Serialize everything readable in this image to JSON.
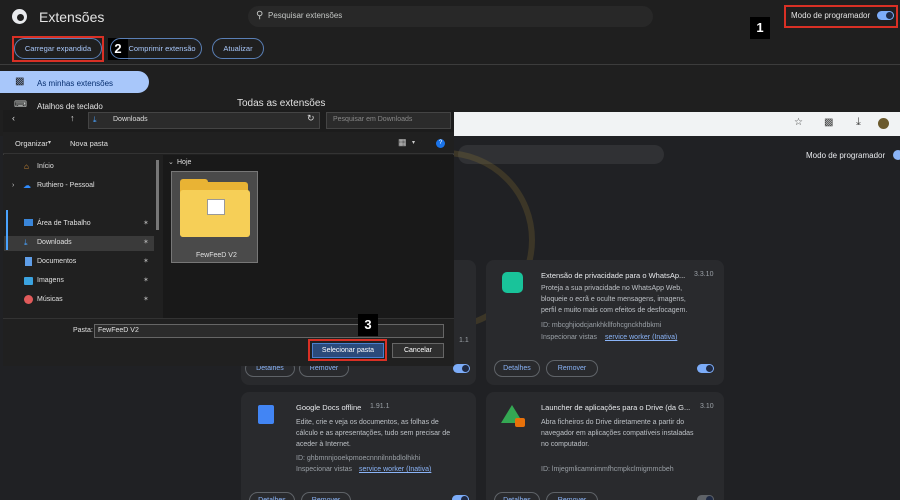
{
  "topbar": {
    "title": "Extensões",
    "search_placeholder": "Pesquisar extensões",
    "devmode_label": "Modo de programador"
  },
  "toolbar": {
    "load_unpacked": "Carregar expandida",
    "pack": "Comprimir extensão",
    "update": "Atualizar"
  },
  "sidebar": {
    "items": [
      {
        "label": "As minhas extensões"
      },
      {
        "label": "Atalhos de teclado"
      }
    ]
  },
  "main": {
    "all_extensions": "Todas as extensões",
    "devmode_label": "Modo de programador"
  },
  "annotations": [
    "1",
    "2",
    "3"
  ],
  "dialog": {
    "path": "Downloads",
    "search_placeholder": "Pesquisar em Downloads",
    "organize": "Organizar",
    "new_folder": "Nova pasta",
    "nav_items": [
      {
        "label": "Início",
        "icon": "home-icon"
      },
      {
        "label": "Ruthiero - Pessoal",
        "icon": "cloud-icon"
      },
      {
        "label": "Área de Trabalho",
        "icon": "desktop-icon"
      },
      {
        "label": "Downloads",
        "icon": "download-icon"
      },
      {
        "label": "Documentos",
        "icon": "document-icon"
      },
      {
        "label": "Imagens",
        "icon": "image-icon"
      },
      {
        "label": "Músicas",
        "icon": "music-icon"
      }
    ],
    "group_label": "Hoje",
    "folder_name": "FewFeeD V2",
    "pasta_label": "Pasta:",
    "pasta_value": "FewFeeD V2",
    "select_button": "Selecionar pasta",
    "cancel_button": "Cancelar"
  },
  "cards": [
    {
      "title": "Extensão de privacidade para o WhatsAp...",
      "version": "3.3.10",
      "description": [
        "Proteja a sua privacidade no WhatsApp Web,",
        "bloqueie o ecrã e oculte mensagens, imagens,",
        "perfil e muito mais com efeitos de desfocagem."
      ],
      "id": "ID: mbcghjiodcjankhkllfohcgnckhdbkmi",
      "inspect": "Inspecionar vistas",
      "inspect_link": "service worker (Inativa)",
      "details": "Detalhes",
      "remove": "Remover"
    },
    {
      "title": "Google Docs offline",
      "version": "1.91.1",
      "description": [
        "Edite, crie e veja os documentos, as folhas de",
        "cálculo e as apresentações, tudo sem precisar de",
        "aceder à Internet."
      ],
      "id": "ID: ghbmnnjooekpmoecnnnilnnbdlolhkhi",
      "inspect": "Inspecionar vistas",
      "inspect_link": "service worker (Inativa)",
      "details": "Detalhes",
      "remove": "Remover"
    },
    {
      "title": "Launcher de aplicações para o Drive (da G...",
      "version": "3.10",
      "description": [
        "Abra ficheiros do Drive diretamente a partir do",
        "navegador em aplicações compatíveis instaladas",
        "no computador."
      ],
      "id": "ID: lmjegmlicamnimmfhcmpkclmigmmcbeh",
      "details": "Detalhes",
      "remove": "Remover"
    },
    {
      "partial_version": "1.1",
      "details": "Detalhes",
      "remove": "Remover"
    }
  ]
}
